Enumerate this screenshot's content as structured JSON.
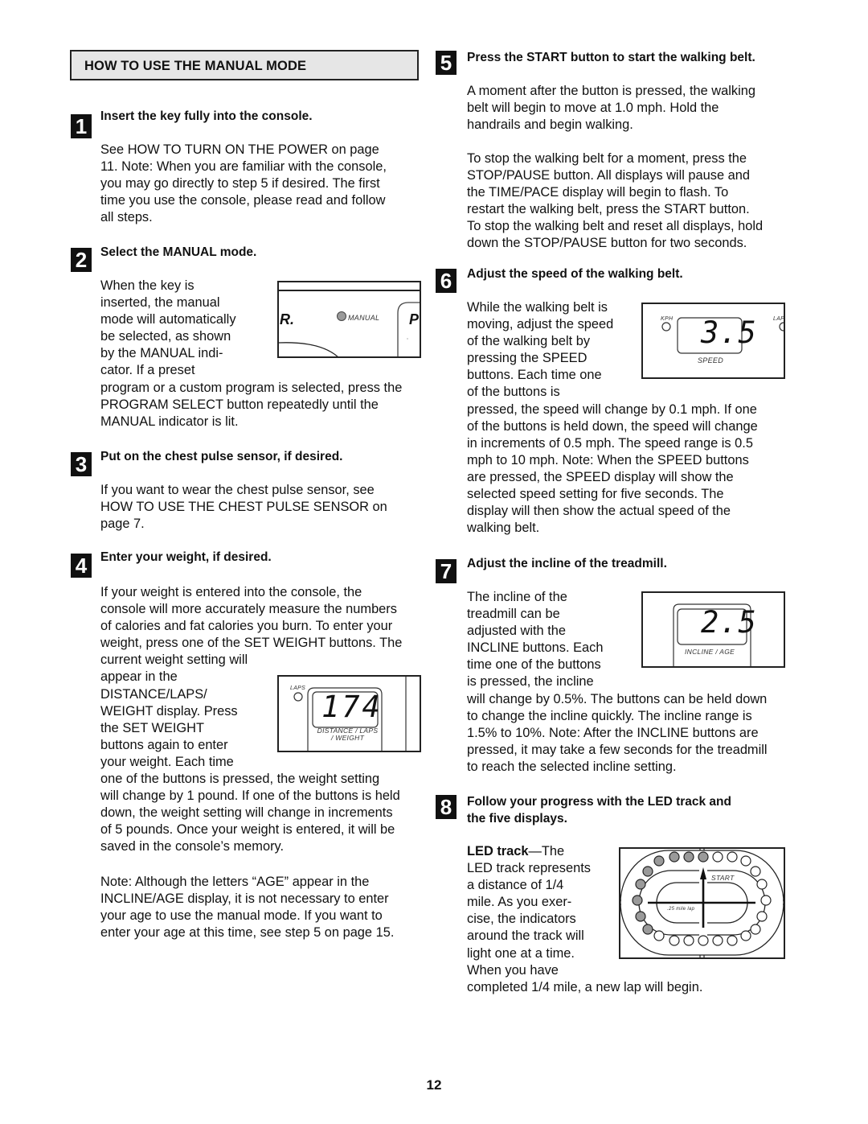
{
  "section_title": "HOW TO USE THE MANUAL MODE",
  "page_number": "12",
  "steps": [
    {
      "number": "1",
      "title": "Insert the key fully into the console.",
      "lines": [
        "See HOW TO TURN ON THE POWER on page",
        "11. Note: When you are familiar with the console,",
        "you may go directly to step 5 if desired. The first",
        "time you use the console, please read and follow",
        "all steps."
      ]
    },
    {
      "number": "2",
      "title": "Select the MANUAL mode.",
      "lines": [
        "When the key is",
        "inserted, the manual",
        "mode will automatically",
        "be selected, as shown",
        "by the MANUAL indi-",
        "cator. If a preset",
        "program or a custom program is selected, press the",
        "PROGRAM SELECT button repeatedly until the",
        "MANUAL indicator is lit."
      ],
      "figure": {
        "indicator_label": "MANUAL",
        "left_glyph": "R.",
        "right_glyph": "P"
      }
    },
    {
      "number": "3",
      "title": "Put on the chest pulse sensor, if desired.",
      "lines": [
        "If you want to wear the chest pulse sensor, see",
        "HOW TO USE THE CHEST PULSE SENSOR on",
        "page 7."
      ]
    },
    {
      "number": "4",
      "title": "Enter your weight, if desired.",
      "lines": [
        "If your weight is entered into the console, the",
        "console will more accurately measure the numbers",
        "of calories and fat calories you burn. To enter your",
        "weight, press one of the SET WEIGHT buttons. The",
        "current weight setting will",
        "appear in the",
        "DISTANCE/LAPS/",
        "WEIGHT display. Press",
        "the SET WEIGHT",
        "buttons again to enter",
        "your weight. Each time",
        "one of the buttons is pressed, the weight setting",
        "will change by 1 pound. If one of the buttons is held",
        "down, the weight setting will change in increments",
        "of 5 pounds. Once your weight is entered, it will be",
        "saved in the console’s memory."
      ],
      "note_lines": [
        "Note: Although the letters “AGE” appear in the",
        "INCLINE/AGE display, it is not necessary to enter",
        "your age to use the manual mode. If you want to",
        "enter your age at this time, see step 5 on page 15."
      ],
      "figure": {
        "indicator_label": "LAPS",
        "value": "174",
        "label_line1": "DISTANCE / LAPS",
        "label_line2": "/ WEIGHT"
      }
    },
    {
      "number": "5",
      "title": "Press the START button to start the walking belt.",
      "lines": [
        "A moment after the button is pressed, the walking",
        "belt will begin to move at 1.0 mph. Hold the",
        "handrails and begin walking."
      ],
      "lines2": [
        "To stop the walking belt for a moment, press the",
        "STOP/PAUSE button. All displays will pause and",
        "the TIME/PACE display will begin to flash. To",
        "restart the walking belt, press the START button.",
        "To stop the walking belt and reset all displays, hold",
        "down the STOP/PAUSE button for two seconds."
      ]
    },
    {
      "number": "6",
      "title": "Adjust the speed of the walking belt.",
      "lines": [
        "While the walking belt is",
        "moving, adjust the speed",
        "of the walking belt by",
        "pressing the SPEED",
        "buttons. Each time one",
        "of the buttons is",
        "pressed, the speed will change by 0.1 mph. If one",
        "of the buttons is held down, the speed will change",
        "in increments of 0.5 mph. The speed range is 0.5",
        "mph to 10 mph. Note: When the SPEED buttons",
        "are pressed, the SPEED display will show the",
        "selected speed setting for five seconds. The",
        "display will then show the actual speed of the",
        "walking belt."
      ],
      "figure": {
        "indicator_left": "KPH",
        "indicator_right": "LAPS",
        "value": "3.5",
        "label": "SPEED"
      }
    },
    {
      "number": "7",
      "title": "Adjust the incline of the treadmill.",
      "lines": [
        "The incline of the",
        "treadmill can be",
        "adjusted with the",
        "INCLINE buttons. Each",
        "time one of the buttons",
        "is pressed, the incline",
        "will change by 0.5%. The buttons can be held down",
        "to change the incline quickly. The incline range is",
        "1.5% to 10%. Note: After the INCLINE buttons are",
        "pressed, it may take a few seconds for the treadmill",
        "to reach the selected incline setting."
      ],
      "figure": {
        "value": "2.5",
        "label": "INCLINE / AGE"
      }
    },
    {
      "number": "8",
      "title_line1": "Follow your progress with the LED track and",
      "title_line2": "the five displays.",
      "lead_bold": "LED track",
      "lead_rest": "—The",
      "lines": [
        "LED track represents",
        "a distance of 1/4",
        "mile. As you exer-",
        "cise, the indicators",
        "around the track will",
        "light one at a time.",
        "When you have",
        "completed 1/4 mile, a new lap will begin."
      ],
      "figure": {
        "start_label": "START",
        "lap_label": ".25 mile lap",
        "led_total": 24,
        "led_lit": 9,
        "lit_color": "#9a9a9a"
      }
    }
  ]
}
